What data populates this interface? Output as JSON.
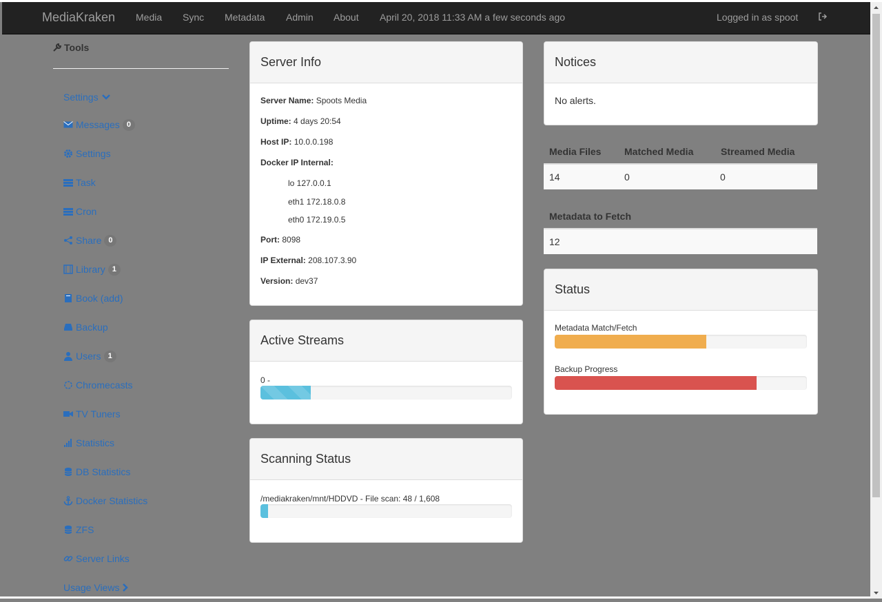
{
  "nav": {
    "brand": "MediaKraken",
    "links": [
      "Media",
      "Sync",
      "Metadata",
      "Admin",
      "About"
    ],
    "datetime": "April 20, 2018 11:33 AM a few seconds ago",
    "user": "Logged in as spoot"
  },
  "sidebar": {
    "title": "Tools",
    "items": [
      {
        "label": "Settings",
        "icon": "chevron-down-icon"
      },
      {
        "label": "Messages",
        "icon": "envelope-icon",
        "badge": "0"
      },
      {
        "label": "Settings",
        "icon": "gear-icon"
      },
      {
        "label": "Task",
        "icon": "list-icon"
      },
      {
        "label": "Cron",
        "icon": "list-icon"
      },
      {
        "label": "Share",
        "icon": "share-icon",
        "badge": "0"
      },
      {
        "label": "Library",
        "icon": "film-icon",
        "badge": "1"
      },
      {
        "label": "Book (add)",
        "icon": "book-icon"
      },
      {
        "label": "Backup",
        "icon": "hdd-icon"
      },
      {
        "label": "Users",
        "icon": "user-icon",
        "badge": "1"
      },
      {
        "label": "Chromecasts",
        "icon": "circle-notch-icon"
      },
      {
        "label": "TV Tuners",
        "icon": "video-camera-icon"
      },
      {
        "label": "Statistics",
        "icon": "signal-icon"
      },
      {
        "label": "DB Statistics",
        "icon": "database-icon"
      },
      {
        "label": "Docker Statistics",
        "icon": "anchor-icon"
      },
      {
        "label": "ZFS",
        "icon": "database-icon"
      },
      {
        "label": "Server Links",
        "icon": "link-icon"
      },
      {
        "label": "Usage Views",
        "icon": "chevron-right-icon"
      }
    ]
  },
  "server_info": {
    "title": "Server Info",
    "server_name_label": "Server Name:",
    "server_name": "Spoots Media",
    "uptime_label": "Uptime:",
    "uptime": "4 days 20:54",
    "host_ip_label": "Host IP:",
    "host_ip": "10.0.0.198",
    "docker_label": "Docker IP Internal:",
    "docker_ips": [
      "lo 127.0.0.1",
      "eth1 172.18.0.8",
      "eth0 172.19.0.5"
    ],
    "port_label": "Port:",
    "port": "8098",
    "ip_external_label": "IP External:",
    "ip_external": "208.107.3.90",
    "version_label": "Version:",
    "version": "dev37"
  },
  "active_streams": {
    "title": "Active Streams",
    "label": "0 -",
    "progress": 0.2
  },
  "scanning": {
    "title": "Scanning Status",
    "label": "/mediakraken/mnt/HDDVD - File scan: 48 / 1,608",
    "progress": 0.03
  },
  "notices": {
    "title": "Notices",
    "message": "No alerts."
  },
  "media_table": {
    "headers": [
      "Media Files",
      "Matched Media",
      "Streamed Media"
    ],
    "values": [
      "14",
      "0",
      "0"
    ]
  },
  "metadata_table": {
    "header": "Metadata to Fetch",
    "value": "12"
  },
  "status": {
    "title": "Status",
    "metadata_label": "Metadata Match/Fetch",
    "metadata_progress": 0.6,
    "backup_label": "Backup Progress",
    "backup_progress": 0.8
  },
  "colors": {
    "navbar": "#222222",
    "link": "#2a6ebd",
    "info": "#5bc0de",
    "warning": "#f0ad4e",
    "danger": "#d9534f"
  }
}
